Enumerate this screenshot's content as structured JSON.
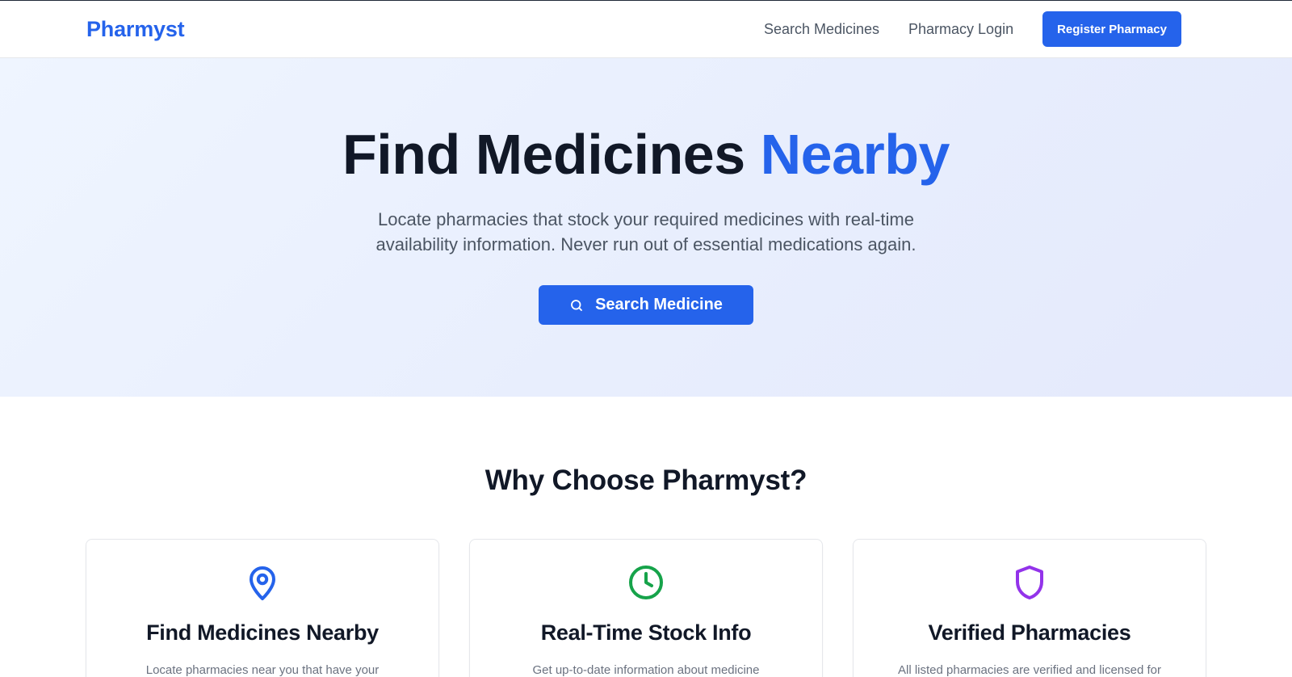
{
  "navbar": {
    "brand": "Pharmyst",
    "links": [
      "Search Medicines",
      "Pharmacy Login"
    ],
    "register_label": "Register Pharmacy"
  },
  "hero": {
    "title_main": "Find Medicines",
    "title_accent": "Nearby",
    "description": "Locate pharmacies that stock your required medicines with real-time availability information. Never run out of essential medications again.",
    "search_button": "Search Medicine"
  },
  "features": {
    "title": "Why Choose Pharmyst?",
    "cards": [
      {
        "icon": "map-pin-icon",
        "title": "Find Medicines Nearby",
        "text": "Locate pharmacies near you that have your",
        "color": "#2563eb"
      },
      {
        "icon": "clock-icon",
        "title": "Real-Time Stock Info",
        "text": "Get up-to-date information about medicine",
        "color": "#16a34a"
      },
      {
        "icon": "shield-icon",
        "title": "Verified Pharmacies",
        "text": "All listed pharmacies are verified and licensed for",
        "color": "#9333ea"
      }
    ]
  },
  "colors": {
    "brand": "#2563eb",
    "heading": "#111827",
    "body_text": "#4b5563"
  }
}
